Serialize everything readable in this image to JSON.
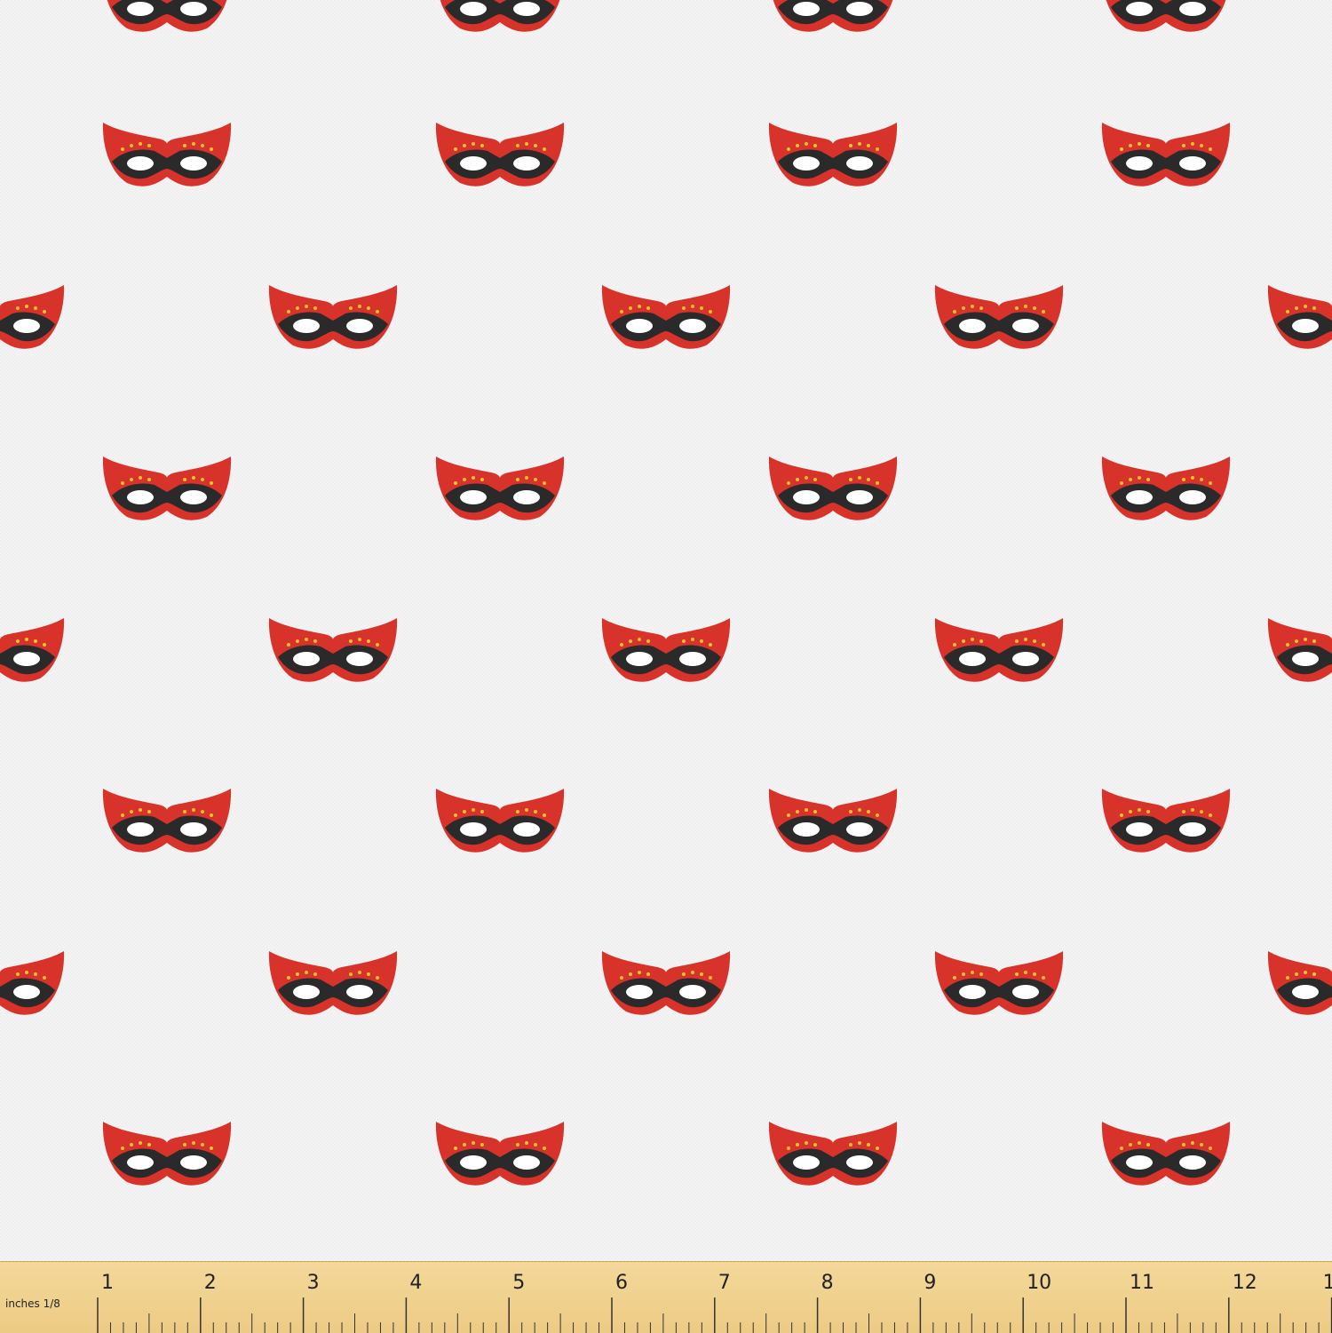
{
  "pattern": {
    "background_color": "#f3f3f3",
    "motif": "masquerade-mask",
    "mask_colors": {
      "base": "#d8332a",
      "shadow": "#b52620",
      "band": "#2a2a2a",
      "eye": "#ffffff",
      "dots": "#f2c12e"
    }
  },
  "ruler": {
    "unit_label": "inches",
    "fraction_label": "1/8",
    "numbers": [
      "1",
      "2",
      "3",
      "4",
      "5",
      "6",
      "7",
      "8",
      "9",
      "10",
      "11",
      "12",
      "1"
    ]
  }
}
